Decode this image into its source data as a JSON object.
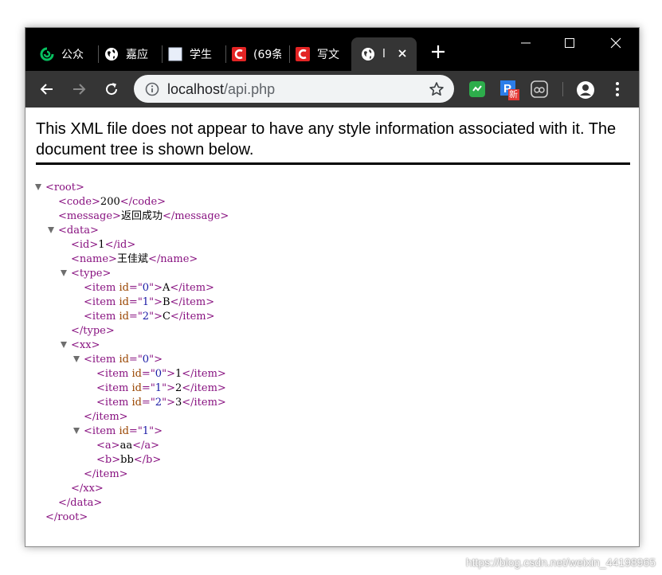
{
  "tabs": [
    {
      "title": "公众",
      "favicon": "wechat-icon"
    },
    {
      "title": "嘉应",
      "favicon": "globe-icon"
    },
    {
      "title": "学生",
      "favicon": "blank-page-icon"
    },
    {
      "title": "(69条",
      "favicon": "csdn-icon"
    },
    {
      "title": "写文",
      "favicon": "csdn-icon"
    },
    {
      "title": "l",
      "favicon": "globe-icon",
      "active": true
    }
  ],
  "address": {
    "host": "localhost",
    "path": "/api.php"
  },
  "extensions": [
    "chat-extension-icon",
    "pinyin-extension-icon",
    "ghost-extension-icon"
  ],
  "ext_badge": "新",
  "banner": "This XML file does not appear to have any style information associated with it. The document tree is shown below.",
  "tree": [
    {
      "d": 0,
      "t": "open",
      "tag": "root",
      "collapsible": true
    },
    {
      "d": 1,
      "t": "leaf",
      "tag": "code",
      "text": "200"
    },
    {
      "d": 1,
      "t": "leaf",
      "tag": "message",
      "text": "返回成功"
    },
    {
      "d": 1,
      "t": "open",
      "tag": "data",
      "collapsible": true
    },
    {
      "d": 2,
      "t": "leaf",
      "tag": "id",
      "text": "1"
    },
    {
      "d": 2,
      "t": "leaf",
      "tag": "name",
      "text": "王佳斌"
    },
    {
      "d": 2,
      "t": "open",
      "tag": "type",
      "collapsible": true
    },
    {
      "d": 3,
      "t": "leaf",
      "tag": "item",
      "attr": "id",
      "val": "0",
      "text": "A"
    },
    {
      "d": 3,
      "t": "leaf",
      "tag": "item",
      "attr": "id",
      "val": "1",
      "text": "B"
    },
    {
      "d": 3,
      "t": "leaf",
      "tag": "item",
      "attr": "id",
      "val": "2",
      "text": "C"
    },
    {
      "d": 2,
      "t": "close",
      "tag": "type"
    },
    {
      "d": 2,
      "t": "open",
      "tag": "xx",
      "collapsible": true
    },
    {
      "d": 3,
      "t": "open",
      "tag": "item",
      "attr": "id",
      "val": "0",
      "collapsible": true
    },
    {
      "d": 4,
      "t": "leaf",
      "tag": "item",
      "attr": "id",
      "val": "0",
      "text": "1"
    },
    {
      "d": 4,
      "t": "leaf",
      "tag": "item",
      "attr": "id",
      "val": "1",
      "text": "2"
    },
    {
      "d": 4,
      "t": "leaf",
      "tag": "item",
      "attr": "id",
      "val": "2",
      "text": "3"
    },
    {
      "d": 3,
      "t": "close",
      "tag": "item"
    },
    {
      "d": 3,
      "t": "open",
      "tag": "item",
      "attr": "id",
      "val": "1",
      "collapsible": true
    },
    {
      "d": 4,
      "t": "leaf",
      "tag": "a",
      "text": "aa"
    },
    {
      "d": 4,
      "t": "leaf",
      "tag": "b",
      "text": "bb"
    },
    {
      "d": 3,
      "t": "close",
      "tag": "item"
    },
    {
      "d": 2,
      "t": "close",
      "tag": "xx"
    },
    {
      "d": 1,
      "t": "close",
      "tag": "data"
    },
    {
      "d": 0,
      "t": "close",
      "tag": "root"
    }
  ],
  "watermark": "https://blog.csdn.net/weixin_44198965",
  "colors": {
    "tag": "#881280",
    "attr_name": "#994500",
    "attr_value": "#1a1aa6",
    "chrome_dark": "#353535"
  }
}
